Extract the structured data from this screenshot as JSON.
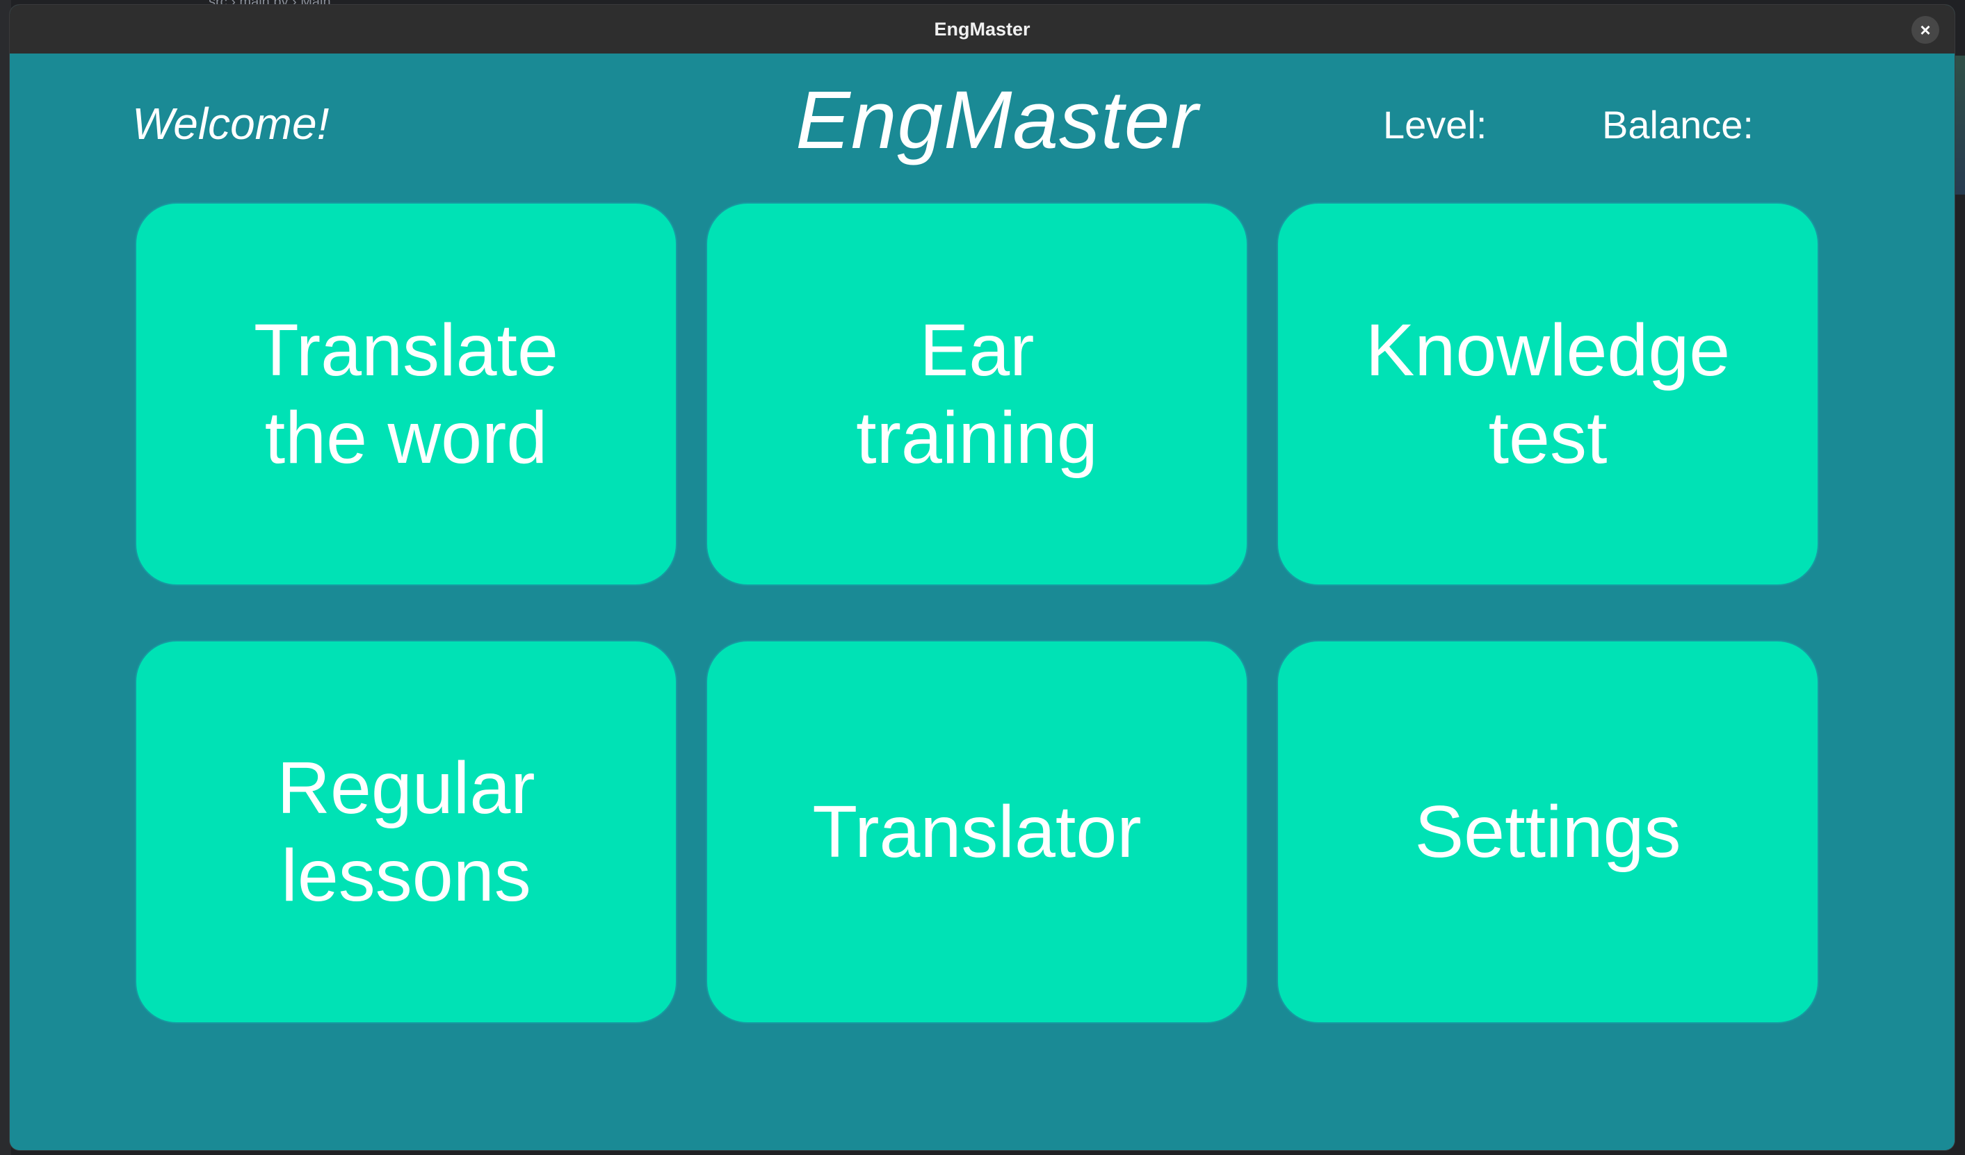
{
  "window": {
    "title": "EngMaster",
    "close_label": "×"
  },
  "header": {
    "welcome": "Welcome!",
    "app_title": "EngMaster",
    "level_label": "Level:",
    "balance_label": "Balance:"
  },
  "menu": {
    "translate_word": "Translate\nthe word",
    "ear_training": "Ear\ntraining",
    "knowledge_test": "Knowledge\ntest",
    "regular_lessons": "Regular\nlessons",
    "translator": "Translator",
    "settings": "Settings"
  },
  "background_editor": {
    "breadcrumb": "src › main.py › Main"
  },
  "colors": {
    "background": "#1a8a95",
    "tile": "#00e2b5",
    "titlebar": "#2e2e2e",
    "text": "#ffffff"
  }
}
